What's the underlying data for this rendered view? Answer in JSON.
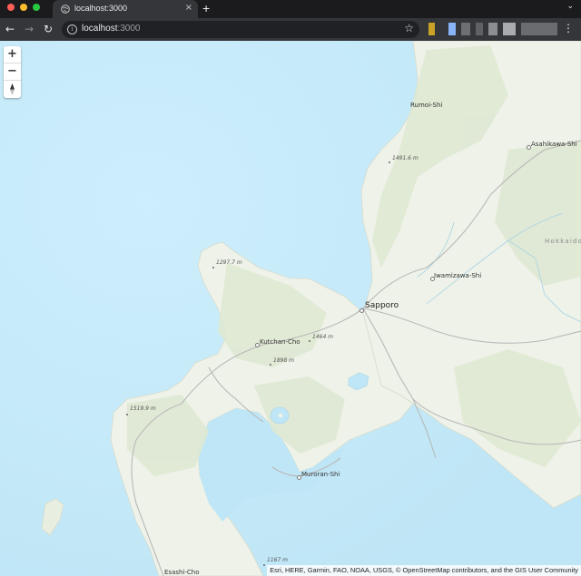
{
  "browser": {
    "tab_title": "localhost:3000",
    "tab_close": "×",
    "new_tab": "+",
    "url_host": "localhost",
    "url_port": ":3000",
    "traffic_lights": [
      "#ff5f57",
      "#febc2e",
      "#28c840"
    ]
  },
  "map": {
    "colors": {
      "water": "#c7eaf8",
      "land": "#eef2e8",
      "forest": "#dfe9d3",
      "road": "#b9b9b9"
    },
    "zoom_in": "+",
    "zoom_out": "−",
    "compass_icon": "compass-icon",
    "cities": {
      "rumoi": "Rumoi-Shi",
      "asahikawa": "Asahikawa-Shi",
      "iwamizawa": "Iwamizawa-Shi",
      "sapporo": "Sapporo",
      "kutchan": "Kutchan-Cho",
      "muroran": "Muroran-Shi",
      "esashi": "Esashi-Cho"
    },
    "region": "Hokkaido",
    "peaks": {
      "p1": "1491.6 m",
      "p2": "1297.7 m",
      "p3": "1464 m",
      "p4": "1898 m",
      "p5": "1519.9 m",
      "p6": "1167 m"
    },
    "attribution": "Esri, HERE, Garmin, FAO, NOAA, USGS, © OpenStreetMap contributors, and the GIS User Community"
  }
}
